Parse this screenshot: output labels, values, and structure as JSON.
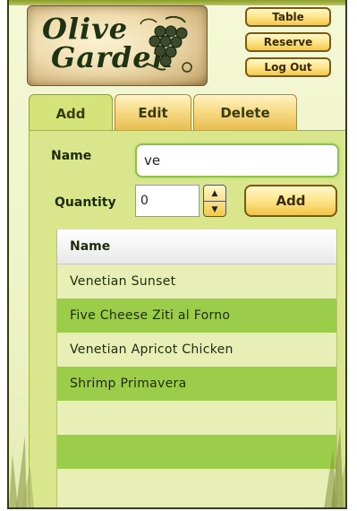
{
  "logo": {
    "line1": "Olive",
    "line2": "Garden"
  },
  "top_nav": {
    "table_label": "Table",
    "reserve_label": "Reserve",
    "logout_label": "Log Out"
  },
  "tabs": [
    {
      "label": "Add",
      "active": true
    },
    {
      "label": "Edit",
      "active": false
    },
    {
      "label": "Delete",
      "active": false
    }
  ],
  "form": {
    "name_label": "Name",
    "name_value": "ve",
    "quantity_label": "Quantity",
    "quantity_value": "0",
    "add_label": "Add",
    "stepper_up": "▲",
    "stepper_down": "▼"
  },
  "list": {
    "header": "Name",
    "items": [
      "Venetian Sunset",
      "Five Cheese Ziti al Forno",
      "Venetian Apricot Chicken",
      "Shrimp Primavera",
      "",
      "",
      ""
    ]
  },
  "colors": {
    "accent_green": "#9ccd4a",
    "panel_green": "#d9e68c",
    "button_gold": "#fde58a"
  }
}
